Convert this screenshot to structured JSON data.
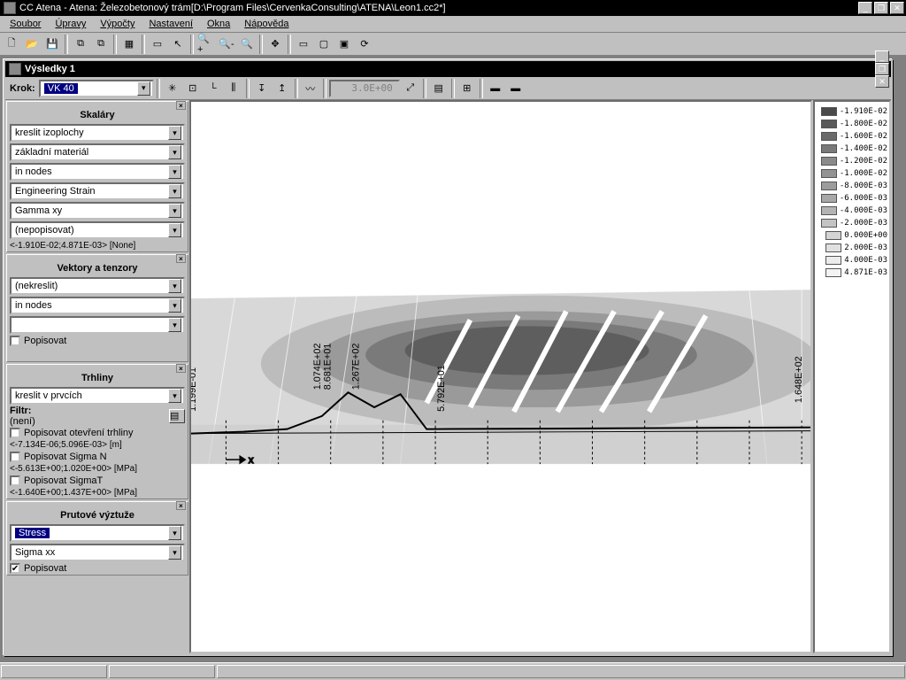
{
  "app": {
    "title": "CC Atena - Atena: Železobetonový trám[D:\\Program Files\\CervenkaConsulting\\ATENA\\Leon1.cc2*]"
  },
  "menu": [
    "Soubor",
    "Úpravy",
    "Výpočty",
    "Nastavení",
    "Okna",
    "Nápověda"
  ],
  "inner": {
    "title": "Výsledky 1",
    "step_label": "Krok:",
    "step_value": "VK 40",
    "readout": "3.0E+00"
  },
  "panels": {
    "skalary": {
      "title": "Skaláry",
      "combos": [
        "kreslit izoplochy",
        "základní materiál",
        "in nodes",
        "Engineering Strain",
        "Gamma xy",
        "(nepopisovat)"
      ],
      "range": "<-1.910E-02;4.871E-03> [None]"
    },
    "vektory": {
      "title": "Vektory a tenzory",
      "combos": [
        "(nekreslit)",
        "in nodes",
        ""
      ],
      "chk": "Popisovat"
    },
    "trhliny": {
      "title": "Trhliny",
      "combo": "kreslit v prvcích",
      "filtr_label": "Filtr:",
      "filtr_value": "(není)",
      "c1": "Popisovat otevření trhliny",
      "r1": "<-7.134E-06;5.096E-03> [m]",
      "c2": "Popisovat Sigma N",
      "r2": "<-5.613E+00;1.020E+00> [MPa]",
      "c3": "Popisovat SigmaT",
      "r3": "<-1.640E+00;1.437E+00> [MPa]"
    },
    "prutove": {
      "title": "Prutové výztuže",
      "combos": [
        "Stress",
        "Sigma xx"
      ],
      "chk": "Popisovat"
    }
  },
  "legend": [
    {
      "c": "#4a4a4a",
      "v": "-1.910E-02"
    },
    {
      "c": "#5a5a5a",
      "v": "-1.800E-02"
    },
    {
      "c": "#6a6a6a",
      "v": "-1.600E-02"
    },
    {
      "c": "#7a7a7a",
      "v": "-1.400E-02"
    },
    {
      "c": "#8a8a8a",
      "v": "-1.200E-02"
    },
    {
      "c": "#939393",
      "v": "-1.000E-02"
    },
    {
      "c": "#9c9c9c",
      "v": "-8.000E-03"
    },
    {
      "c": "#a8a8a8",
      "v": "-6.000E-03"
    },
    {
      "c": "#b4b4b4",
      "v": "-4.000E-03"
    },
    {
      "c": "#c4c4c4",
      "v": "-2.000E-03"
    },
    {
      "c": "#d4d4d4",
      "v": "0.000E+00"
    },
    {
      "c": "#e0e0e0",
      "v": "2.000E-03"
    },
    {
      "c": "#ececec",
      "v": "4.000E-03"
    },
    {
      "c": "#f3f3f3",
      "v": "4.871E-03"
    }
  ],
  "annotations": [
    "1.199E-01",
    "1.074E+02",
    "8.681E+01",
    "1.267E+02",
    "5.792E+01",
    "1.648E+02"
  ]
}
